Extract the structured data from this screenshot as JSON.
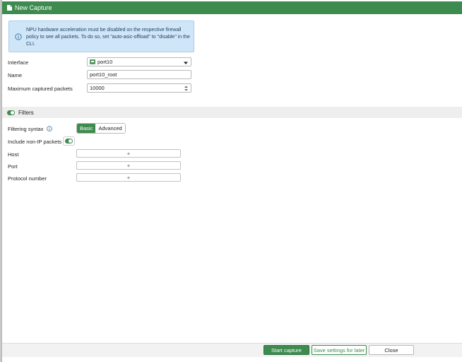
{
  "window": {
    "title": "New Capture",
    "accent_color": "#3e8b4f"
  },
  "info": {
    "icon": "info-icon",
    "text": "NPU hardware acceleration must be disabled on the respective firewall policy to see all packets. To do so, set \"auto-asic-offload\" to \"disable\" in the CLI."
  },
  "form": {
    "interface_label": "Interface",
    "interface_value": "port10",
    "name_label": "Name",
    "name_value": "port10_root",
    "max_packets_label": "Maximum captured packets",
    "max_packets_value": "10000"
  },
  "filters": {
    "enabled": true,
    "label": "Filters",
    "syntax_label": "Filtering syntax",
    "syntax_options": [
      "Basic",
      "Advanced"
    ],
    "syntax_selected": "Basic",
    "non_ip_label": "Include non-IP packets",
    "non_ip_enabled": true,
    "host_label": "Host",
    "port_label": "Port",
    "protocol_label": "Protocol number",
    "add_symbol": "+"
  },
  "footer": {
    "start_label": "Start capture",
    "save_label": "Save settings for later",
    "close_label": "Close"
  }
}
